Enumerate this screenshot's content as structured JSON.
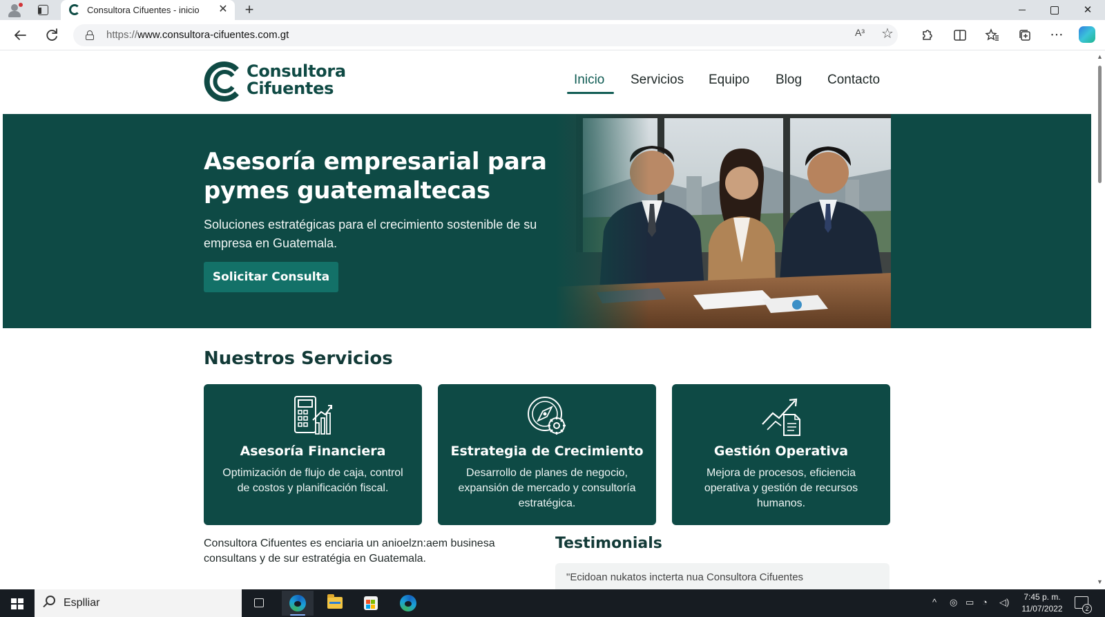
{
  "browser": {
    "tab_title": "Consultora Cifuentes - inicio",
    "tab_close": "✕",
    "new_tab": "+",
    "url_protocol": "https://",
    "url_host": "www.consultora-cifuentes.com.gt",
    "read_aloud": "A³"
  },
  "site": {
    "logo_line1": "Consultora",
    "logo_line2": "Cifuentes",
    "brand_color": "#0e4a45",
    "accent_color": "#137168",
    "nav": [
      {
        "label": "Inicio",
        "active": true
      },
      {
        "label": "Servicios"
      },
      {
        "label": "Equipo"
      },
      {
        "label": "Blog"
      },
      {
        "label": "Contacto"
      }
    ],
    "hero": {
      "title": "Asesoría empresarial para pymes guatemaltecas",
      "subtitle": "Soluciones estratégicas para el crecimiento sostenible de su empresa en Guatemala.",
      "cta": "Solicitar Consulta"
    },
    "services_title": "Nuestros Servicios",
    "services": [
      {
        "icon": "calculator-chart-icon",
        "title": "Asesoría Financiera",
        "desc": "Optimización de flujo de caja, control de costos y planificación fiscal."
      },
      {
        "icon": "compass-gear-icon",
        "title": "Estrategia de Crecimiento",
        "desc": "Desarrollo de planes de negocio, expansión de mercado y consultoría estratégica."
      },
      {
        "icon": "growth-document-icon",
        "title": "Gestión Operativa",
        "desc": "Mejora de procesos, eficiencia operativa y gestión de recursos humanos."
      }
    ],
    "about_text": "Consultora Cifuentes es enciaria un anioelzn:aem businesa consultans y de sur estratégia en Guatemala.",
    "testimonials_title": "Testimonials",
    "testimonial_preview": "\"Ecidoan nukatos incterta nua Consultora Cifuentes"
  },
  "taskbar": {
    "search_text": "Esplliar",
    "time": "7:45 p. m.",
    "date": "11/07/2022",
    "notification_count": "2"
  }
}
